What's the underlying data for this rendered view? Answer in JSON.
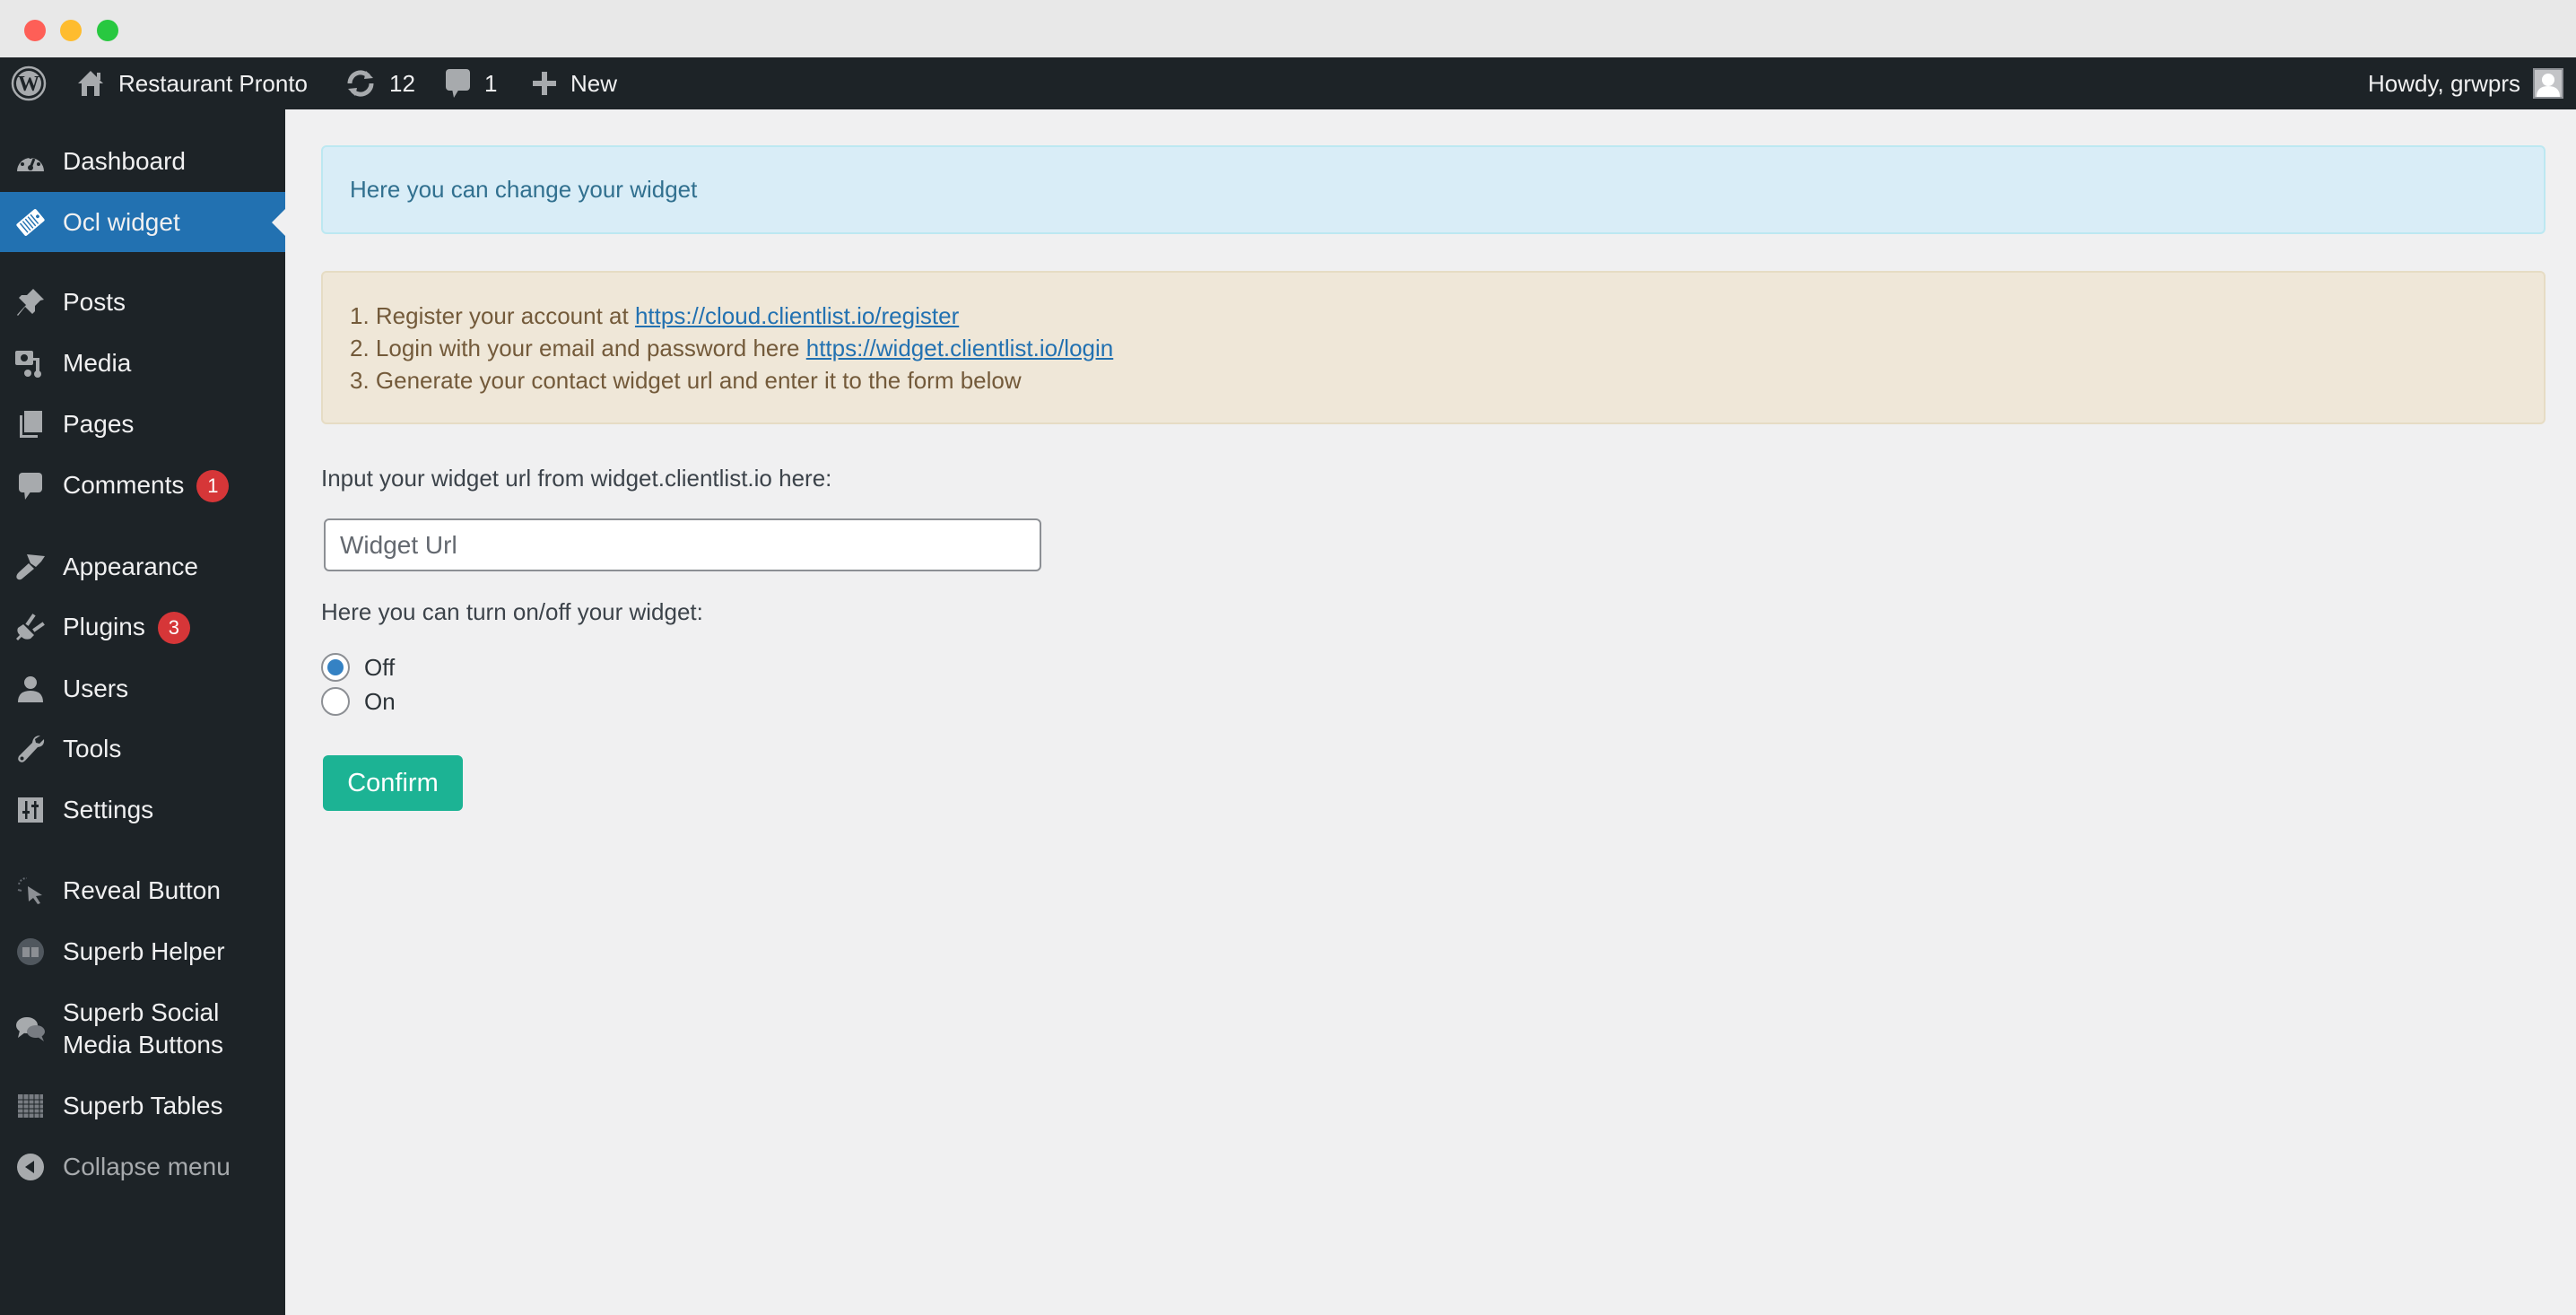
{
  "window": {
    "controls": [
      "close",
      "minimize",
      "maximize"
    ]
  },
  "adminbar": {
    "wp_logo_icon": "wordpress-logo-icon",
    "site_icon": "home-icon",
    "site_name": "Restaurant Pronto",
    "updates_icon": "update-icon",
    "updates_count": "12",
    "comments_icon": "comment-icon",
    "comments_count": "1",
    "new_icon": "plus-icon",
    "new_label": "New",
    "greeting": "Howdy, grwprs",
    "avatar_icon": "user-avatar-icon"
  },
  "sidebar": {
    "items": [
      {
        "label": "Dashboard",
        "icon": "dashboard-icon"
      },
      {
        "label": "Ocl widget",
        "icon": "tag-widget-icon",
        "active": true
      },
      {
        "label": "Posts",
        "icon": "pushpin-icon"
      },
      {
        "label": "Media",
        "icon": "media-icon"
      },
      {
        "label": "Pages",
        "icon": "pages-icon"
      },
      {
        "label": "Comments",
        "icon": "comment-icon",
        "badge": "1"
      },
      {
        "label": "Appearance",
        "icon": "paintbrush-icon"
      },
      {
        "label": "Plugins",
        "icon": "plug-icon",
        "badge": "3"
      },
      {
        "label": "Users",
        "icon": "user-icon"
      },
      {
        "label": "Tools",
        "icon": "wrench-icon"
      },
      {
        "label": "Settings",
        "icon": "sliders-icon"
      },
      {
        "label": "Reveal Button",
        "icon": "cursor-click-icon"
      },
      {
        "label": "Superb Helper",
        "icon": "book-circle-icon"
      },
      {
        "label_line1": "Superb Social",
        "label_line2": "Media Buttons",
        "icon": "chat-bubbles-icon"
      },
      {
        "label": "Superb Tables",
        "icon": "table-grid-icon"
      },
      {
        "label": "Collapse menu",
        "icon": "collapse-arrow-icon"
      }
    ]
  },
  "main": {
    "info_alert": "Here you can change your widget",
    "steps": [
      {
        "text": "1. Register your account at ",
        "link": "https://cloud.clientlist.io/register"
      },
      {
        "text": "2. Login with your email and password here ",
        "link": "https://widget.clientlist.io/login"
      },
      {
        "text": "3. Generate your contact widget url and enter it to the form below"
      }
    ],
    "url_label": "Input your widget url from widget.clientlist.io here:",
    "url_input": {
      "value": "",
      "placeholder": "Widget Url"
    },
    "toggle_label": "Here you can turn on/off your widget:",
    "toggle_options": [
      {
        "label": "Off",
        "checked": true
      },
      {
        "label": "On",
        "checked": false
      }
    ],
    "confirm_label": "Confirm"
  },
  "colors": {
    "adminbar_bg": "#1d2327",
    "sidebar_active": "#2271b1",
    "badge": "#d63638",
    "info_bg": "#d9edf7",
    "info_text": "#31708f",
    "steps_bg": "#efe7d8",
    "steps_text": "#735a3a",
    "link": "#2271b1",
    "confirm_bg": "#1cb394",
    "radio_checked": "#3582c4"
  }
}
